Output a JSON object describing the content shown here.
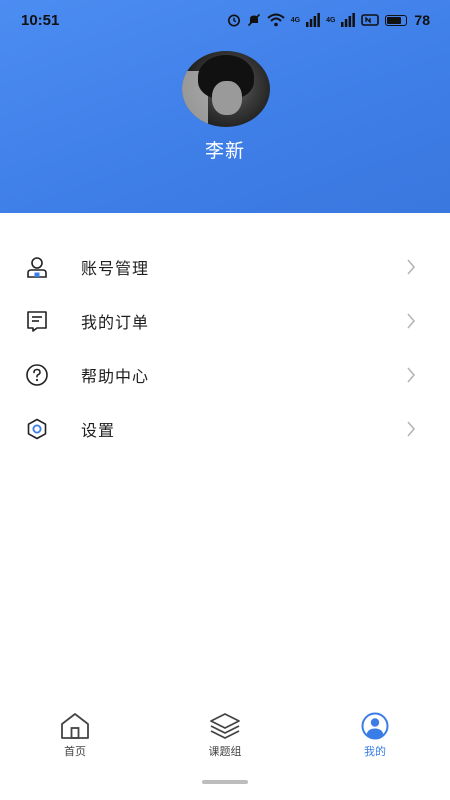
{
  "status_bar": {
    "time": "10:51",
    "battery_level": "78",
    "network_1": "4G",
    "network_2": "4G"
  },
  "profile": {
    "username": "李新"
  },
  "menu": {
    "items": [
      {
        "label": "账号管理",
        "icon": "user-icon"
      },
      {
        "label": "我的订单",
        "icon": "order-icon"
      },
      {
        "label": "帮助中心",
        "icon": "help-icon"
      },
      {
        "label": "设置",
        "icon": "settings-icon"
      }
    ]
  },
  "tabbar": {
    "tabs": [
      {
        "label": "首页",
        "icon": "home-icon",
        "active": false
      },
      {
        "label": "课题组",
        "icon": "layers-icon",
        "active": false
      },
      {
        "label": "我的",
        "icon": "profile-icon",
        "active": true
      }
    ]
  },
  "colors": {
    "header_blue": "#4686ee",
    "accent": "#3a7de6"
  }
}
